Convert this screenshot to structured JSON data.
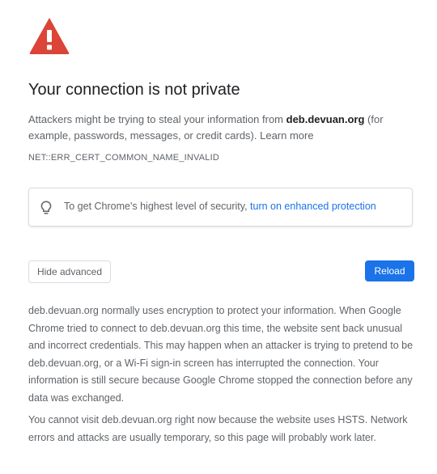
{
  "warning": {
    "icon": "warning-triangle-icon",
    "color": "#db4437"
  },
  "title": "Your connection is not private",
  "intro": {
    "prefix": "Attackers might be trying to steal your information from ",
    "domain": "deb.devuan.org",
    "suffix": " (for example, passwords, messages, or credit cards). ",
    "learn_more": "Learn more"
  },
  "error_code": "NET::ERR_CERT_COMMON_NAME_INVALID",
  "enhanced_protection": {
    "icon": "lightbulb-icon",
    "text": "To get Chrome's highest level of security, ",
    "link": "turn on enhanced protection"
  },
  "buttons": {
    "hide_advanced": "Hide advanced",
    "reload": "Reload"
  },
  "colors": {
    "accent": "#1a73e8",
    "text": "#202124",
    "secondary_text": "#5f6368"
  },
  "details": {
    "paragraph1": "deb.devuan.org normally uses encryption to protect your information. When Google Chrome tried to connect to deb.devuan.org this time, the website sent back unusual and incorrect credentials. This may happen when an attacker is trying to pretend to be deb.devuan.org, or a Wi-Fi sign-in screen has interrupted the connection. Your information is still secure because Google Chrome stopped the connection before any data was exchanged.",
    "paragraph2": "You cannot visit deb.devuan.org right now because the website uses HSTS. Network errors and attacks are usually temporary, so this page will probably work later."
  }
}
